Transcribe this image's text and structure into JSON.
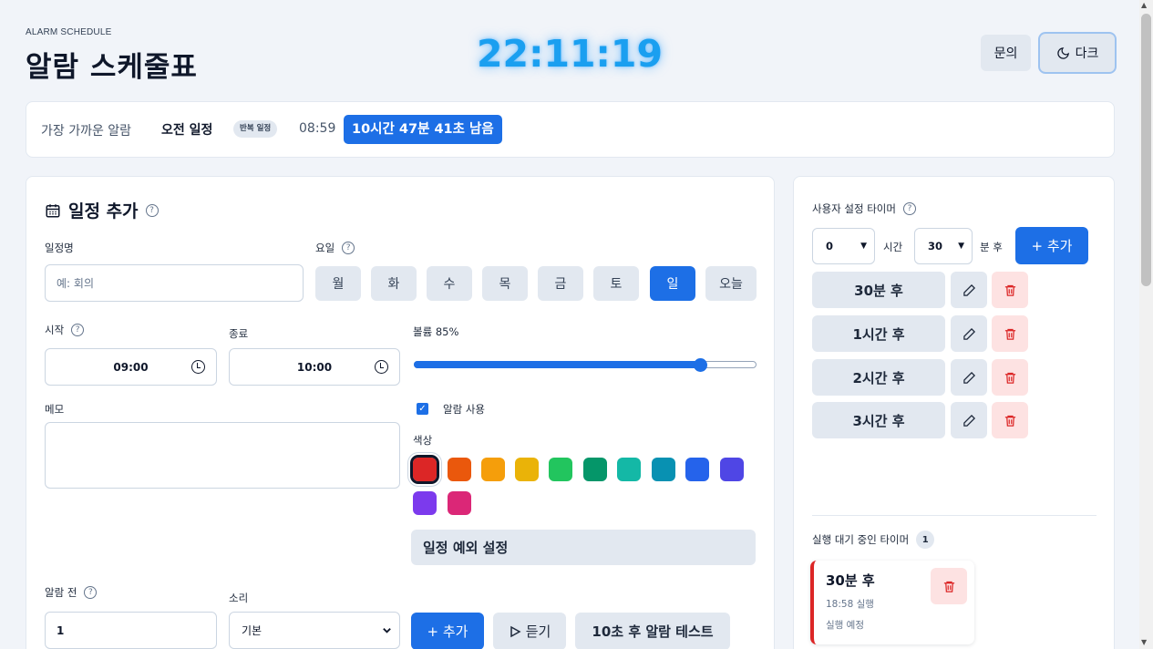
{
  "header": {
    "eyebrow": "ALARM SCHEDULE",
    "title": "알람 스케줄표",
    "clock": "22:11:19",
    "inquiry_label": "문의",
    "dark_label": "다크"
  },
  "next_alarm": {
    "label": "가장 가까운 알람",
    "name": "오전 일정",
    "badge": "반복 일정",
    "time": "08:59",
    "remaining": "10시간 47분 41초 남음"
  },
  "form": {
    "section_title": "일정 추가",
    "name_label": "일정명",
    "name_placeholder": "예: 회의",
    "days_label": "요일",
    "days": [
      "월",
      "화",
      "수",
      "목",
      "금",
      "토",
      "일",
      "오늘"
    ],
    "active_day": "일",
    "start_label": "시작",
    "start_value": "09:00",
    "end_label": "종료",
    "end_value": "10:00",
    "volume_label": "볼륨 85%",
    "volume": 0.85,
    "memo_label": "메모",
    "enabled_label": "알람 사용",
    "enabled": true,
    "color_label": "색상",
    "colors": [
      "#dc2626",
      "#ea580c",
      "#f59e0b",
      "#eab308",
      "#22c55e",
      "#059669",
      "#14b8a6",
      "#0891b2",
      "#2563eb",
      "#4f46e5",
      "#7c3aed",
      "#db2777"
    ],
    "selected_color": "#dc2626",
    "exception_label": "일정 예외 설정",
    "pre_alarm_label": "알람 전",
    "pre_alarm_value": "1",
    "sound_label": "소리",
    "sound_value": "기본",
    "add_label": "+ 추가",
    "listen_label": "듣기",
    "test_label": "10초 후 알람 테스트"
  },
  "timers": {
    "section_title": "사용자 설정 타이머",
    "hours_value": "0",
    "hours_unit": "시간",
    "minutes_value": "30",
    "minutes_unit": "분 후",
    "add_label": "+ 추가",
    "presets": [
      "30분 후",
      "1시간 후",
      "2시간 후",
      "3시간 후"
    ]
  },
  "pending": {
    "section_title": "실행 대기 중인 타이머",
    "count": "1",
    "items": [
      {
        "name": "30분 후",
        "time": "18:58 실행",
        "status": "실행 예정"
      }
    ]
  }
}
